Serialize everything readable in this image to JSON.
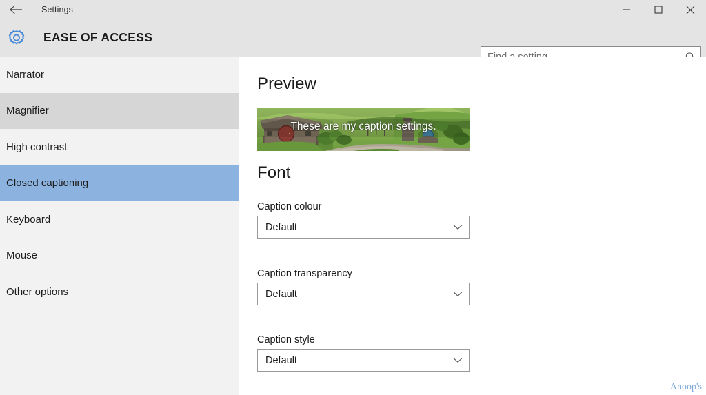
{
  "window": {
    "title": "Settings",
    "back_icon": "back-arrow-icon",
    "controls": {
      "minimize": "minimize-icon",
      "maximize": "maximize-icon",
      "close": "close-icon"
    }
  },
  "header": {
    "icon": "gear-icon",
    "title": "EASE OF ACCESS"
  },
  "search": {
    "placeholder": "Find a setting",
    "value": "",
    "icon": "search-icon"
  },
  "sidebar": {
    "items": [
      {
        "label": "Narrator",
        "state": "normal"
      },
      {
        "label": "Magnifier",
        "state": "hover"
      },
      {
        "label": "High contrast",
        "state": "normal"
      },
      {
        "label": "Closed captioning",
        "state": "selected"
      },
      {
        "label": "Keyboard",
        "state": "normal"
      },
      {
        "label": "Mouse",
        "state": "normal"
      },
      {
        "label": "Other options",
        "state": "normal"
      }
    ]
  },
  "content": {
    "preview": {
      "heading": "Preview",
      "caption_text": "These are my caption settings.",
      "image_description": "hobbit-hole-hillside-photo"
    },
    "font": {
      "heading": "Font",
      "fields": [
        {
          "label": "Caption colour",
          "value": "Default",
          "chevron": "chevron-down-icon"
        },
        {
          "label": "Caption transparency",
          "value": "Default",
          "chevron": "chevron-down-icon"
        },
        {
          "label": "Caption style",
          "value": "Default",
          "chevron": "chevron-down-icon"
        }
      ]
    }
  },
  "watermark": {
    "text": "Anoop's"
  },
  "colors": {
    "titlebar_bg": "#e4e4e4",
    "header_bg": "#e4e4e4",
    "sidebar_bg": "#f2f2f2",
    "content_bg": "#ffffff",
    "nav_hover": "#d6d6d6",
    "nav_selected": "#8cb3e0",
    "accent_blue": "#4a8bd8",
    "watermark": "#7fa8d8"
  }
}
